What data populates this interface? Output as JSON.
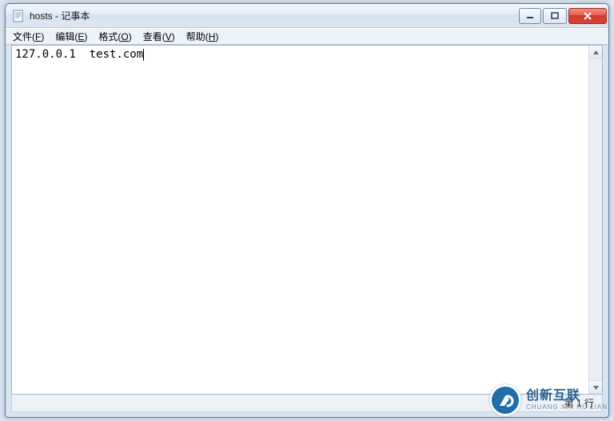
{
  "window": {
    "title": "hosts - 记事本"
  },
  "menu": {
    "file": {
      "label": "文件",
      "mnemonic": "F"
    },
    "edit": {
      "label": "编辑",
      "mnemonic": "E"
    },
    "format": {
      "label": "格式",
      "mnemonic": "O"
    },
    "view": {
      "label": "查看",
      "mnemonic": "V"
    },
    "help": {
      "label": "帮助",
      "mnemonic": "H"
    }
  },
  "editor": {
    "content": "127.0.0.1  test.com"
  },
  "status": {
    "position": "第 1 行"
  },
  "watermark": {
    "cn": "创新互联",
    "en": "CHUANG XIN HU LIAN"
  }
}
